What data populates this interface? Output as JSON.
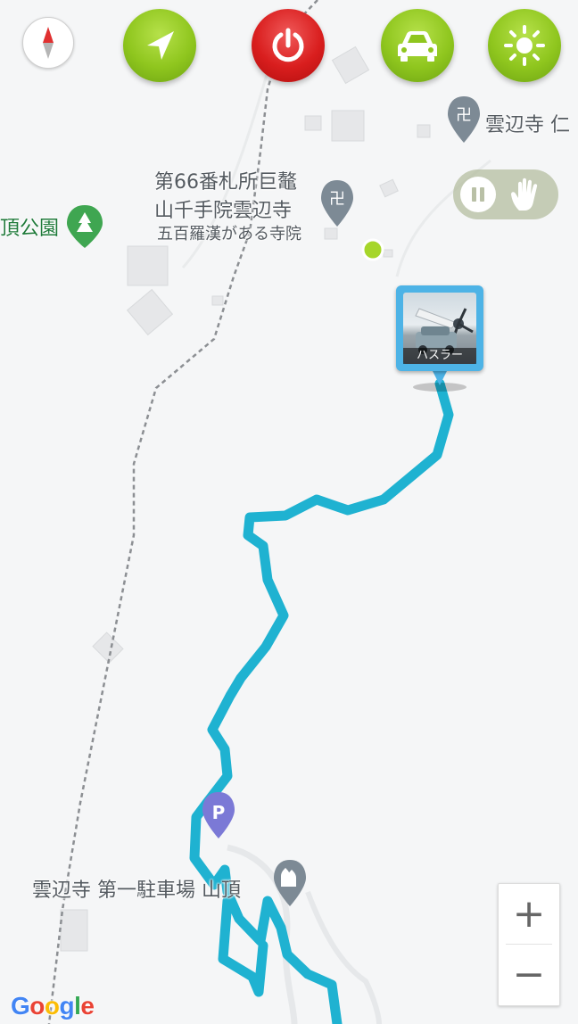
{
  "toolbar": {
    "compass_icon": "compass-icon",
    "navigate_icon": "navigation-arrow-icon",
    "power_icon": "power-icon",
    "car_icon": "car-icon",
    "brightness_icon": "sun-icon",
    "colors": {
      "green": "#8fc61e",
      "red": "#d91e1e"
    }
  },
  "map": {
    "route_color": "#1fb2d1",
    "places": [
      {
        "id": "temple-top",
        "label": "雲辺寺 仁"
      },
      {
        "id": "temple-66-line1",
        "label": "第66番札所巨鼇"
      },
      {
        "id": "temple-66-line2",
        "label": "山千手院雲辺寺"
      },
      {
        "id": "temple-66-line3",
        "label": "五百羅漢がある寺院"
      },
      {
        "id": "park",
        "label": "頂公園"
      },
      {
        "id": "parking",
        "label": "雲辺寺 第一駐車場 山頂"
      }
    ],
    "parking_letter": "P"
  },
  "tracking": {
    "pause_icon": "pause-icon",
    "hand_icon": "hand-icon"
  },
  "vehicle": {
    "name": "ハスラー"
  },
  "zoom": {
    "in": "+",
    "out": "−"
  },
  "attribution": {
    "letters": [
      "G",
      "o",
      "o",
      "g",
      "l",
      "e"
    ],
    "colors": [
      "#4285f4",
      "#ea4335",
      "#fbbc05",
      "#4285f4",
      "#34a853",
      "#ea4335"
    ]
  }
}
